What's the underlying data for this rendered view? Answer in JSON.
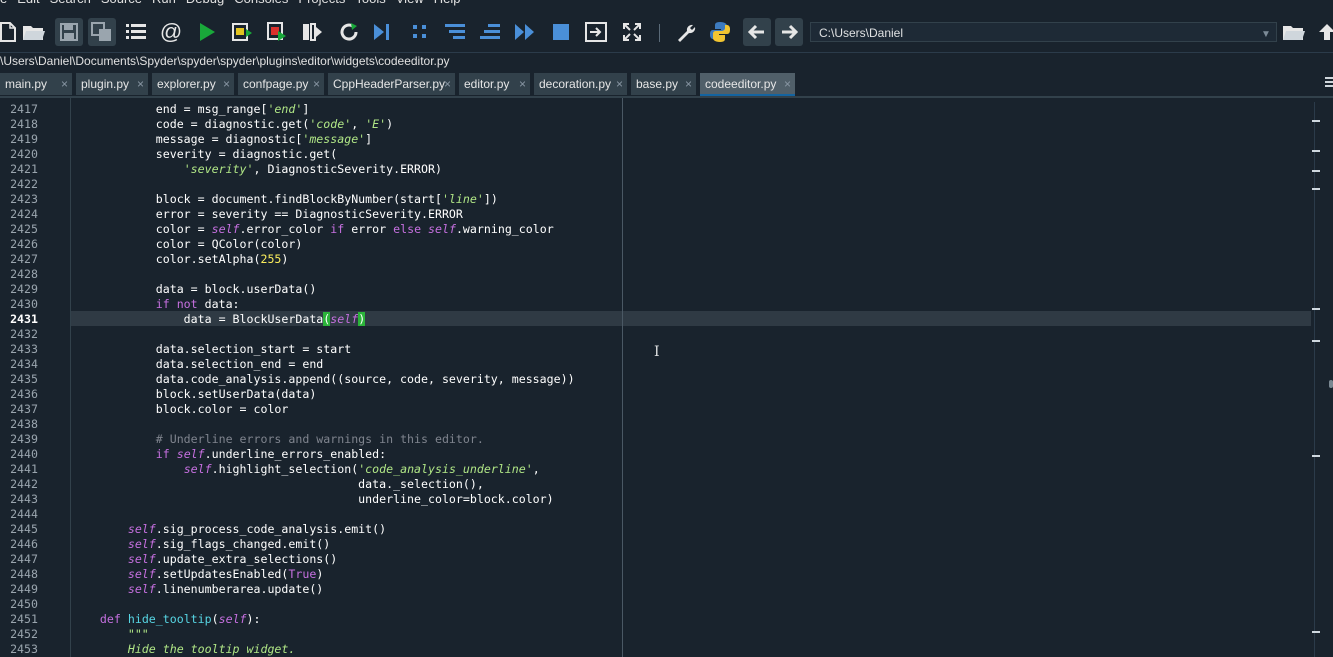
{
  "menus": [
    "e",
    "Edit",
    "Search",
    "Source",
    "Run",
    "Debug",
    "Consoles",
    "Projects",
    "Tools",
    "View",
    "Help"
  ],
  "toolbar": {
    "icons": [
      "new-file-icon",
      "open-folder-icon",
      "save-icon",
      "save-all-icon",
      "outline-list-icon",
      "at-icon",
      "run-icon",
      "run-cell-icon",
      "run-cell-advance-icon",
      "run-selection-icon",
      "rerun-icon",
      "debug-icon",
      "step-icon",
      "step-into-icon",
      "step-return-icon",
      "continue-icon",
      "stop-icon",
      "maximize-pane-icon",
      "fullscreen-icon",
      "wrench-icon",
      "python-icon",
      "back-arrow-icon",
      "forward-arrow-icon",
      "browse-folder-icon",
      "parent-dir-icon"
    ],
    "working_dir": "C:\\Users\\Daniel"
  },
  "file_path": "\\Users\\Daniel\\Documents\\Spyder\\spyder\\spyder\\plugins\\editor\\widgets\\codeeditor.py",
  "tabs": [
    {
      "label": "main.py"
    },
    {
      "label": "plugin.py"
    },
    {
      "label": "explorer.py"
    },
    {
      "label": "confpage.py"
    },
    {
      "label": "CppHeaderParser.py"
    },
    {
      "label": "editor.py"
    },
    {
      "label": "decoration.py"
    },
    {
      "label": "base.py"
    },
    {
      "label": "codeeditor.py",
      "active": true
    }
  ],
  "editor": {
    "current_line": 2431,
    "lines": [
      {
        "n": 2417,
        "html": "            end = msg_range[<span class=\"str\">'end'</span>]"
      },
      {
        "n": 2418,
        "html": "            code = diagnostic.get(<span class=\"str\">'code'</span>, <span class=\"str\">'E'</span>)"
      },
      {
        "n": 2419,
        "html": "            message = diagnostic[<span class=\"str\">'message'</span>]"
      },
      {
        "n": 2420,
        "html": "            severity = diagnostic.get("
      },
      {
        "n": 2421,
        "html": "                <span class=\"str\">'severity'</span>, DiagnosticSeverity.ERROR)"
      },
      {
        "n": 2422,
        "html": ""
      },
      {
        "n": 2423,
        "html": "            block = document.findBlockByNumber(start[<span class=\"str\">'line'</span>])"
      },
      {
        "n": 2424,
        "html": "            error = severity == DiagnosticSeverity.ERROR"
      },
      {
        "n": 2425,
        "html": "            color = <span class=\"self\">self</span>.error_color <span class=\"kw\">if</span> error <span class=\"kw\">else</span> <span class=\"self\">self</span>.warning_color"
      },
      {
        "n": 2426,
        "html": "            color = QColor(color)"
      },
      {
        "n": 2427,
        "html": "            color.setAlpha(<span class=\"num\">255</span>)"
      },
      {
        "n": 2428,
        "html": ""
      },
      {
        "n": 2429,
        "html": "            data = block.userData()"
      },
      {
        "n": 2430,
        "html": "            <span class=\"kw\">if not</span> data:"
      },
      {
        "n": 2431,
        "html": "                data = BlockUserData<span class=\"bm\">(</span><span class=\"self\">self</span><span class=\"bm\">)</span>"
      },
      {
        "n": 2432,
        "html": ""
      },
      {
        "n": 2433,
        "html": "            data.selection_start = start"
      },
      {
        "n": 2434,
        "html": "            data.selection_end = end"
      },
      {
        "n": 2435,
        "html": "            data.code_analysis.append((source, code, severity, message))"
      },
      {
        "n": 2436,
        "html": "            block.setUserData(data)"
      },
      {
        "n": 2437,
        "html": "            block.color = color"
      },
      {
        "n": 2438,
        "html": ""
      },
      {
        "n": 2439,
        "html": "            <span class=\"cmt\"># Underline errors and warnings in this editor.</span>"
      },
      {
        "n": 2440,
        "html": "            <span class=\"kw\">if</span> <span class=\"self\">self</span>.underline_errors_enabled:"
      },
      {
        "n": 2441,
        "html": "                <span class=\"self\">self</span>.highlight_selection(<span class=\"str\">'code_analysis_underline'</span>,"
      },
      {
        "n": 2442,
        "html": "                                         data._selection(),"
      },
      {
        "n": 2443,
        "html": "                                         underline_color=block.color)"
      },
      {
        "n": 2444,
        "html": ""
      },
      {
        "n": 2445,
        "html": "        <span class=\"self\">self</span>.sig_process_code_analysis.emit()"
      },
      {
        "n": 2446,
        "html": "        <span class=\"self\">self</span>.sig_flags_changed.emit()"
      },
      {
        "n": 2447,
        "html": "        <span class=\"self\">self</span>.update_extra_selections()"
      },
      {
        "n": 2448,
        "html": "        <span class=\"self\">self</span>.setUpdatesEnabled(<span class=\"kw\">True</span>)"
      },
      {
        "n": 2449,
        "html": "        <span class=\"self\">self</span>.linenumberarea.update()"
      },
      {
        "n": 2450,
        "html": ""
      },
      {
        "n": 2451,
        "html": "    <span class=\"kw\">def</span> <span class=\"def\">hide_tooltip</span>(<span class=\"self\">self</span>):"
      },
      {
        "n": 2452,
        "html": "        <span class=\"doc\">\"\"\"</span>"
      },
      {
        "n": 2453,
        "html": "        <span class=\"doc\">Hide the tooltip widget.</span>"
      }
    ]
  },
  "colors": {
    "background": "#19232d",
    "accent": "#1464a0",
    "current_line": "#2f3a44",
    "bracket_match": "#2bb33a"
  }
}
